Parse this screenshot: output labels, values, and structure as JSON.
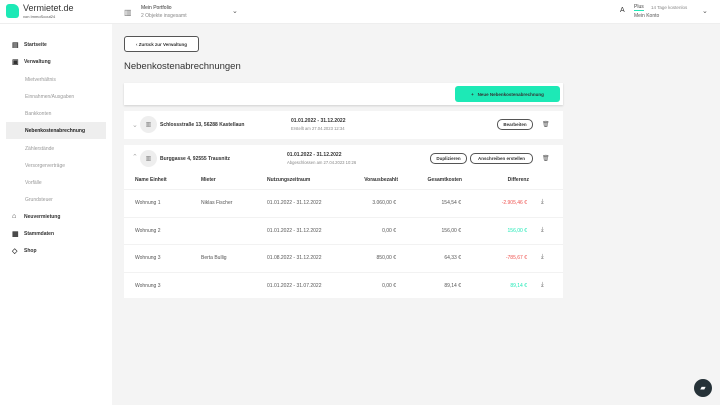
{
  "header": {
    "brand": "Vermietet.de",
    "brand_sub": "von ImmoScout24",
    "portfolio_title": "Mein Portfolio",
    "portfolio_sub": "2 Objekte insgesamt",
    "plan": "Plus",
    "trial": "14 Tage kostenlos",
    "account": "Mein Konto"
  },
  "sidebar": {
    "items": [
      {
        "label": "Startseite"
      },
      {
        "label": "Verwaltung"
      },
      {
        "label": "Mietverhältnis"
      },
      {
        "label": "Einnahmen/Ausgaben"
      },
      {
        "label": "Bankkonten"
      },
      {
        "label": "Nebenkostenabrechnung"
      },
      {
        "label": "Zählerstände"
      },
      {
        "label": "Versorgerverträge"
      },
      {
        "label": "Vorfälle"
      },
      {
        "label": "Grundsteuer"
      },
      {
        "label": "Neuvermietung"
      },
      {
        "label": "Stammdaten"
      },
      {
        "label": "Shop"
      }
    ]
  },
  "main": {
    "back_label": "Zurück zur Verwaltung",
    "title": "Nebenkostenabrechnungen",
    "new_label": "Neue Nebenkostenabrechnung",
    "properties": [
      {
        "address": "Schlossstraße 13, 56288 Kastellaun",
        "period": "01.01.2022 - 31.12.2022",
        "status": "Erstellt am 27.04.2023 12:34",
        "edit_label": "Bearbeiten"
      },
      {
        "address": "Burggasse 4, 92555 Trausnitz",
        "period": "01.01.2022 - 31.12.2022",
        "status": "Abgeschlossen am 27.04.2023 10:26",
        "duplicate_label": "Duplizieren",
        "letter_label": "Anschreiben erstellen"
      }
    ],
    "columns": [
      "Name Einheit",
      "Mieter",
      "Nutzungszeitraum",
      "Vorausbezahlt",
      "Gesamtkosten",
      "Differenz"
    ],
    "rows": [
      {
        "unit": "Wohnung 1",
        "tenant": "Niklas Fischer",
        "period": "01.01.2022 - 31.12.2022",
        "prepaid": "3.060,00 €",
        "total": "154,54 €",
        "diff": "-2.905,46 €"
      },
      {
        "unit": "Wohnung 2",
        "tenant": "",
        "period": "01.01.2022 - 31.12.2022",
        "prepaid": "0,00 €",
        "total": "156,00 €",
        "diff": "156,00 €"
      },
      {
        "unit": "Wohnung 3",
        "tenant": "Berta Bullig",
        "period": "01.08.2022 - 31.12.2022",
        "prepaid": "850,00 €",
        "total": "64,33 €",
        "diff": "-785,67 €"
      },
      {
        "unit": "Wohnung 3",
        "tenant": "",
        "period": "01.01.2022 - 31.07.2022",
        "prepaid": "0,00 €",
        "total": "89,14 €",
        "diff": "89,14 €"
      }
    ]
  },
  "colors": {
    "accent": "#1de9b6",
    "negative": "#ef5350"
  }
}
